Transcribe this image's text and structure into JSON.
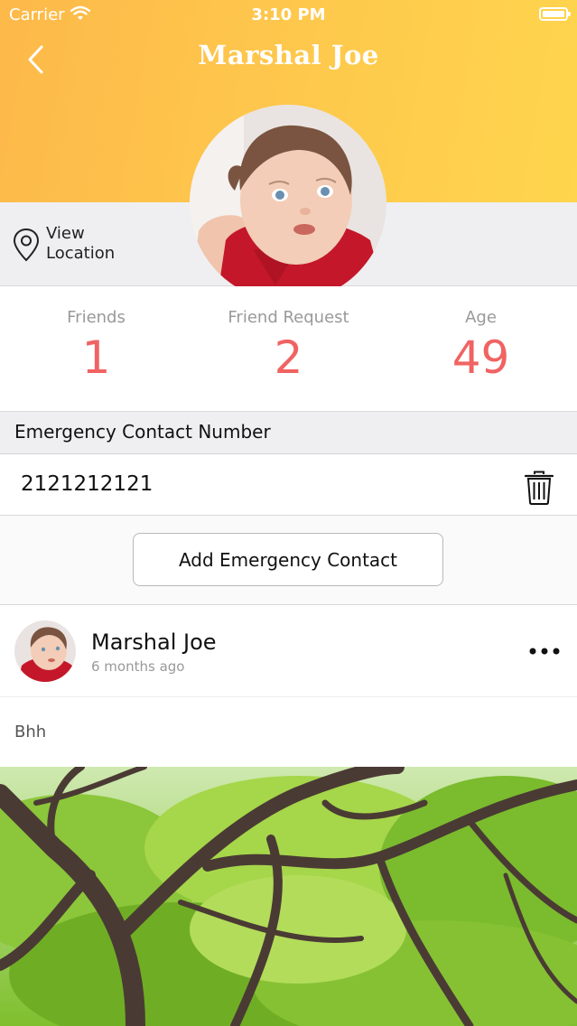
{
  "status_bar": {
    "carrier": "Carrier",
    "time": "3:10 PM"
  },
  "header": {
    "title": "Marshal Joe",
    "back_icon": "chevron-left-icon"
  },
  "location": {
    "label": "View Location",
    "icon": "map-pin-icon"
  },
  "stats": [
    {
      "label": "Friends",
      "value": "1"
    },
    {
      "label": "Friend Request",
      "value": "2"
    },
    {
      "label": "Age",
      "value": "49"
    }
  ],
  "emergency": {
    "title": "Emergency Contact Number",
    "contacts": [
      {
        "number": "2121212121",
        "delete_icon": "trash-icon"
      }
    ],
    "add_button_label": "Add Emergency Contact"
  },
  "post": {
    "author": "Marshal Joe",
    "time_ago": "6 months ago",
    "text": "Bhh",
    "more_icon": "more-horizontal-icon"
  },
  "colors": {
    "header_start": "#fdb94a",
    "header_end": "#ffd54d",
    "stat_value": "#f06363",
    "section_bg": "#efeff1"
  }
}
